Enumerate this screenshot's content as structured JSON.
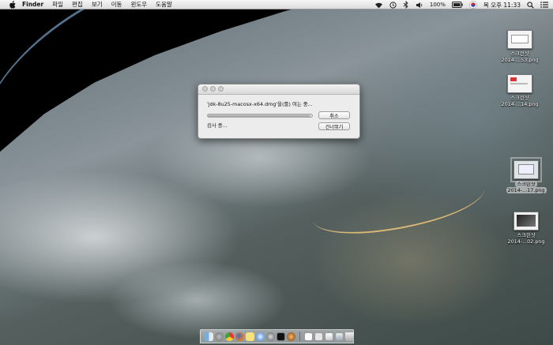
{
  "menubar": {
    "apple_icon": "apple-logo-icon",
    "app_name": "Finder",
    "items": [
      "파일",
      "편집",
      "보기",
      "이동",
      "윈도우",
      "도움말"
    ],
    "status": {
      "battery": "100%",
      "clock": "목 오후 11:33"
    }
  },
  "dialog": {
    "message": "'jdk-8u25-macosx-x64.dmg'을(를) 여는 중...",
    "status": "검사 중...",
    "cancel_label": "취소",
    "skip_label": "건너뛰기",
    "progress": 0.98
  },
  "desktop_icons": [
    {
      "title": "스크린샷",
      "filename": "2014-...53.png"
    },
    {
      "title": "스크린샷",
      "filename": "2014-...14.png"
    },
    {
      "title": "스크린샷",
      "filename": "2014-...17.png"
    },
    {
      "title": "스크린샷",
      "filename": "2014-...02.png"
    }
  ],
  "dock": {
    "apps": [
      "finder-icon",
      "launchpad-icon",
      "chrome-icon",
      "firefox-icon",
      "notes-icon",
      "safari-icon",
      "compass-icon",
      "terminal-icon",
      "dvd-player-icon"
    ],
    "stacks": [
      "document-icon",
      "mail-icon",
      "image-icon",
      "photo-icon",
      "trash-icon"
    ]
  },
  "colors": {
    "menubar_bg": "#e8e8e8",
    "dialog_bg": "#ececec"
  }
}
